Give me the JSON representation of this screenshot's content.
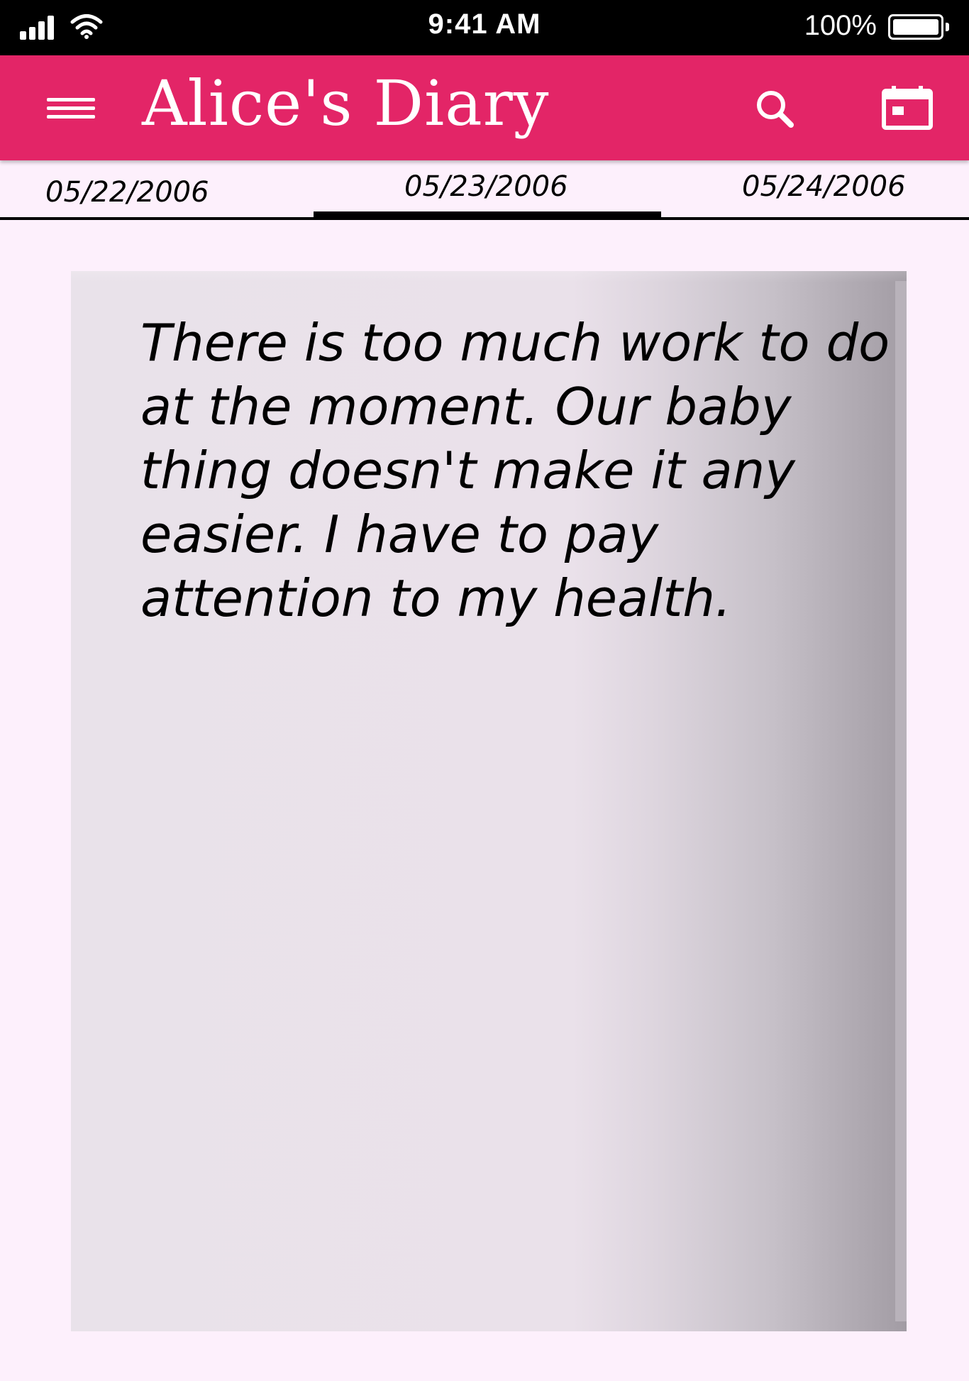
{
  "status_bar": {
    "time": "9:41 AM",
    "battery_percent": "100%",
    "battery_level": 1.0,
    "signal_icon": "cellular-signal-icon",
    "wifi_icon": "wifi-icon",
    "battery_icon": "battery-icon"
  },
  "app_bar": {
    "title": "Alice's Diary",
    "menu_icon": "hamburger-menu-icon",
    "search_icon": "search-icon",
    "calendar_icon": "calendar-icon",
    "background_color": "#e32567"
  },
  "tabs": [
    {
      "label": "05/22/2006",
      "active": false
    },
    {
      "label": "05/23/2006",
      "active": true
    },
    {
      "label": "05/24/2006",
      "active": false
    }
  ],
  "entry": {
    "text": "There is too much work to do at the moment. Our baby thing doesn't make it any easier. I have to pay attention to my health."
  },
  "colors": {
    "accent": "#e32567",
    "background": "#fdf0fc",
    "page": "#eae1ea"
  }
}
